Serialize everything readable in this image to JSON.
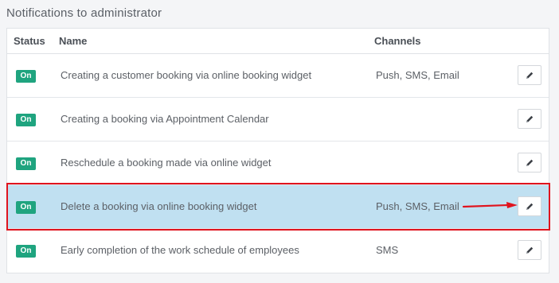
{
  "section": {
    "title": "Notifications to administrator"
  },
  "table": {
    "headers": {
      "status": "Status",
      "name": "Name",
      "channels": "Channels"
    },
    "rows": [
      {
        "status": "On",
        "name": "Creating a customer booking via online booking widget",
        "channels": "Push, SMS, Email",
        "highlighted": false
      },
      {
        "status": "On",
        "name": "Creating a booking via Appointment Calendar",
        "channels": "",
        "highlighted": false
      },
      {
        "status": "On",
        "name": "Reschedule a booking made via online widget",
        "channels": "",
        "highlighted": false
      },
      {
        "status": "On",
        "name": "Delete a booking via online booking widget",
        "channels": "Push, SMS, Email",
        "highlighted": true
      },
      {
        "status": "On",
        "name": "Early completion of the work schedule of employees",
        "channels": "SMS",
        "highlighted": false
      }
    ]
  },
  "icons": {
    "edit": "pencil-icon",
    "annotation": "red-arrow-icon"
  },
  "colors": {
    "status_on": "#1fa47f",
    "highlight_row": "#c0e0f1",
    "annotation": "#e0141e"
  }
}
